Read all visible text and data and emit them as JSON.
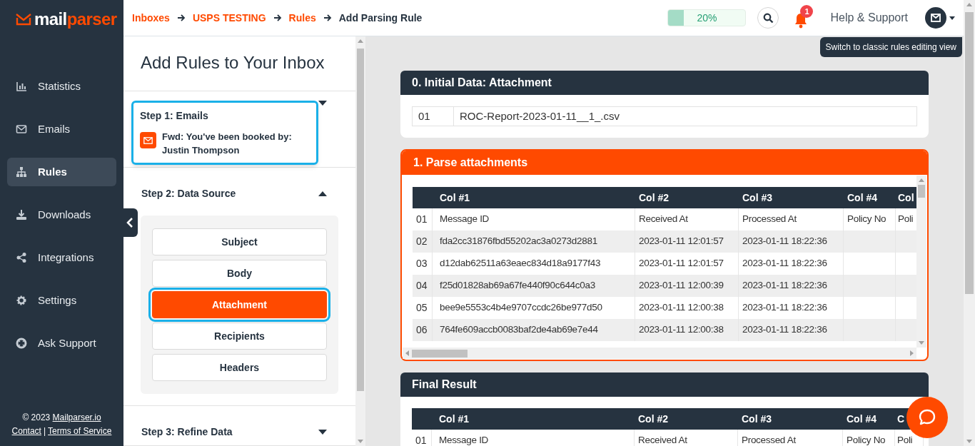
{
  "logo": {
    "lead": "mail",
    "tail": "parser"
  },
  "nav": [
    {
      "label": "Statistics",
      "selected": false
    },
    {
      "label": "Emails",
      "selected": false
    },
    {
      "label": "Rules",
      "selected": true
    },
    {
      "label": "Downloads",
      "selected": false
    },
    {
      "label": "Integrations",
      "selected": false
    },
    {
      "label": "Settings",
      "selected": false
    },
    {
      "label": "Ask Support",
      "selected": false
    }
  ],
  "footer": {
    "copyright": "© 2023",
    "site_link": "Mailparser.io",
    "contact_link": "Contact",
    "separator": "|",
    "terms_link": "Terms of Service"
  },
  "breadcrumb": [
    {
      "label": "Inboxes",
      "kind": "link"
    },
    {
      "label": "USPS TESTING",
      "kind": "link"
    },
    {
      "label": "Rules",
      "kind": "link"
    },
    {
      "label": "Add Parsing Rule",
      "kind": "current"
    }
  ],
  "quota": {
    "level": 0.2,
    "reading": "20%"
  },
  "notifications": {
    "count": "1"
  },
  "help": "Help & Support",
  "tooltip": "Switch to classic rules editing view",
  "panel": {
    "title": "Add Rules to Your Inbox",
    "steps": [
      {
        "title": "Step 1: Emails",
        "expanded": false,
        "highlighted": true,
        "email": "Fwd: You've been booked by: Justin Thompson"
      },
      {
        "title": "Step 2: Data Source",
        "expanded": true,
        "highlighted": false,
        "sources": [
          {
            "label": "Subject",
            "selected": false,
            "highlighted": false
          },
          {
            "label": "Body",
            "selected": false,
            "highlighted": false
          },
          {
            "label": "Attachment",
            "selected": true,
            "highlighted": true
          },
          {
            "label": "Recipients",
            "selected": false,
            "highlighted": false
          },
          {
            "label": "Headers",
            "selected": false,
            "highlighted": false
          }
        ]
      },
      {
        "title": "Step 3: Refine Data",
        "expanded": false,
        "highlighted": false
      }
    ]
  },
  "cards": [
    {
      "title": "0. Initial Data: Attachment",
      "kind": "dark",
      "rows": [
        {
          "index": "01",
          "cells": [
            "ROC-Report-2023-01-11__1_.csv"
          ]
        }
      ]
    },
    {
      "title": "1. Parse attachments",
      "kind": "active",
      "columns": [
        "Col #1",
        "Col #2",
        "Col #3",
        "Col #4",
        "Col"
      ],
      "rows": [
        {
          "index": "01",
          "cells": [
            "Message ID",
            "Received At",
            "Processed At",
            "Policy No",
            "Poli"
          ]
        },
        {
          "index": "02",
          "cells": [
            "fda2cc31876fbd55202ac3a0273d2881",
            "2023-01-11 12:01:57",
            "2023-01-11 18:22:36",
            "",
            ""
          ]
        },
        {
          "index": "03",
          "cells": [
            "d12dab62511a63eaec834d18a9177f43",
            "2023-01-11 12:01:57",
            "2023-01-11 18:22:36",
            "",
            ""
          ]
        },
        {
          "index": "04",
          "cells": [
            "f25d01828ab69a67fe440f90c644c0a3",
            "2023-01-11 12:00:39",
            "2023-01-11 18:22:36",
            "",
            ""
          ]
        },
        {
          "index": "05",
          "cells": [
            "bee9e5553c4b4e9707ccdc26be977d50",
            "2023-01-11 12:00:38",
            "2023-01-11 18:22:36",
            "",
            ""
          ]
        },
        {
          "index": "06",
          "cells": [
            "764fe609accb0083baf2de4ab69e7e44",
            "2023-01-11 12:00:38",
            "2023-01-11 18:22:36",
            "",
            ""
          ]
        }
      ]
    },
    {
      "title": "Final Result",
      "kind": "dark",
      "columns": [
        "Col #1",
        "Col #2",
        "Col #3",
        "Col #4",
        "C"
      ],
      "rows": [
        {
          "index": "01",
          "cells": [
            "Message ID",
            "Received At",
            "Processed At",
            "Policy No",
            "Poli"
          ]
        }
      ]
    }
  ]
}
